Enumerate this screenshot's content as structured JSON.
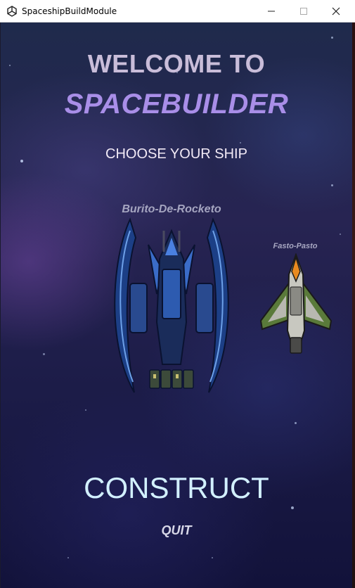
{
  "window": {
    "title": "SpaceshipBuildModule"
  },
  "menu": {
    "welcome_line": "WELCOME TO",
    "game_title": "SPACEBUILDER",
    "prompt": "CHOOSE YOUR SHIP",
    "construct_label": "CONSTRUCT",
    "quit_label": "QUIT"
  },
  "ships": [
    {
      "name": "Burito-De-Rocketo",
      "selected": true
    },
    {
      "name": "Fasto-Pasto",
      "selected": false
    }
  ],
  "colors": {
    "welcome_text": "#c9bdd9",
    "title_text": "#a98ee8",
    "construct_text": "#d2f0ff",
    "background": "#1f2a4c"
  },
  "icons": {
    "app": "unity-logo-icon",
    "minimize": "minimize-icon",
    "maximize": "maximize-icon",
    "close": "close-icon"
  }
}
